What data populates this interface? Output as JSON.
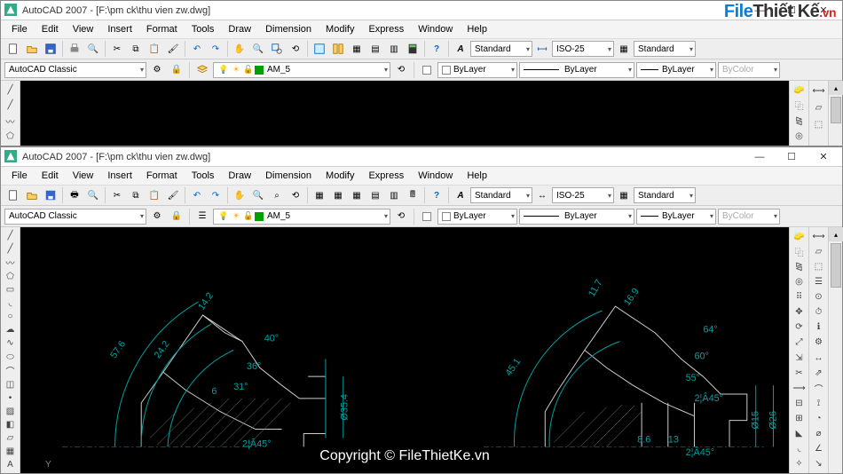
{
  "app_title": "AutoCAD 2007 - [F:\\pm ck\\thu vien zw.dwg]",
  "menus": [
    "File",
    "Edit",
    "View",
    "Insert",
    "Format",
    "Tools",
    "Draw",
    "Dimension",
    "Modify",
    "Express",
    "Window",
    "Help"
  ],
  "style_dd1": "Standard",
  "style_dd2": "ISO-25",
  "style_dd3": "Standard",
  "ws_name": "AutoCAD Classic",
  "layer_name": "AM_5",
  "layer_color_sw": "#00a000",
  "prop_bylayer": "ByLayer",
  "prop_bycolor": "ByColor",
  "watermark": "Copyright © FileThietKe.vn",
  "logo": {
    "a": "File",
    "b": "Thiết Kế",
    "c": ".vn"
  },
  "axis_label": "Y",
  "dims_left": {
    "d576": "57.6",
    "d242": "24.2",
    "d142": "14.2",
    "d6": "6",
    "d40": "40°",
    "d36": "36°",
    "d31": "31°",
    "d354": "Ø35.4",
    "ch45": "2¦Â45°"
  },
  "dims_right": {
    "d451": "45.1",
    "d117": "11.7",
    "d169": "16.9",
    "d64": "64°",
    "d60": "60°",
    "d55": "55°",
    "d86": "8.6",
    "d13": "13",
    "d15": "Ø15",
    "d26": "Ø26",
    "ch45a": "2¦Â45°",
    "ch45b": "2¦Â45°"
  }
}
